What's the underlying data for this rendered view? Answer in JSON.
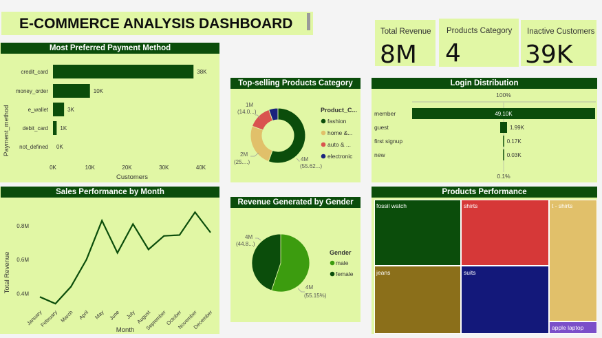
{
  "header": {
    "title": "E-COMMERCE ANALYSIS DASHBOARD"
  },
  "kpis": [
    {
      "label": "Total Revenue",
      "value": "8M"
    },
    {
      "label": "Products Category",
      "value": "4"
    },
    {
      "label": "Inactive Customers",
      "value": "39K"
    }
  ],
  "colors": {
    "panel": "#e1f7a5",
    "title_bar": "#0b4d0b",
    "dark_green": "#0b4d0b",
    "accent_green": "#3c9c0f"
  },
  "payment": {
    "title": "Most Preferred Payment Method",
    "ylabel": "Payment_method",
    "xlabel": "Customers",
    "ticks": [
      "0K",
      "10K",
      "20K",
      "30K",
      "40K"
    ],
    "chart_data": {
      "type": "bar",
      "orientation": "horizontal",
      "categories": [
        "credit_card",
        "money_order",
        "e_wallet",
        "debit_card",
        "not_defined"
      ],
      "values": [
        38000,
        10000,
        3000,
        1000,
        0
      ],
      "data_labels": [
        "38K",
        "10K",
        "3K",
        "1K",
        "0K"
      ],
      "xlim": [
        0,
        40000
      ]
    }
  },
  "category": {
    "title": "Top-selling Products Category",
    "legend_title": "Product_C...",
    "legend": [
      "fashion",
      "home &...",
      "auto & ...",
      "electronic"
    ],
    "labels": [
      {
        "line1": "4M",
        "line2": "(55.62...)"
      },
      {
        "line1": "2M",
        "line2": "(25....)"
      },
      {
        "line1": "1M",
        "line2": "(14.0...)"
      }
    ],
    "chart_data": {
      "type": "pie",
      "variant": "donut",
      "categories": [
        "fashion",
        "home & ...",
        "auto & ...",
        "electronic"
      ],
      "values": [
        55.62,
        25,
        14,
        5.38
      ],
      "colors": [
        "#0b4d0b",
        "#e1c06a",
        "#d9534f",
        "#1a237e"
      ]
    }
  },
  "login": {
    "title": "Login Distribution",
    "top_label": "100%",
    "bottom_label": "0.1%",
    "chart_data": {
      "type": "bar",
      "variant": "funnel",
      "categories": [
        "member",
        "guest",
        "first signup",
        "new"
      ],
      "values": [
        49100,
        1990,
        170,
        30
      ],
      "data_labels": [
        "49.10K",
        "1.99K",
        "0.17K",
        "0.03K"
      ]
    }
  },
  "sales": {
    "title": "Sales Performance by Month",
    "ylabel": "Total Revenue",
    "xlabel": "Month",
    "yticks": [
      "0.8M",
      "0.6M",
      "0.4M"
    ],
    "chart_data": {
      "type": "line",
      "categories": [
        "January",
        "February",
        "March",
        "April",
        "May",
        "June",
        "July",
        "August",
        "September",
        "October",
        "November",
        "December"
      ],
      "values": [
        0.38,
        0.34,
        0.44,
        0.6,
        0.83,
        0.64,
        0.81,
        0.66,
        0.74,
        0.745,
        0.88,
        0.76
      ],
      "ylim": [
        0.3,
        0.95
      ]
    }
  },
  "gender": {
    "title": "Revenue Generated by Gender",
    "legend_title": "Gender",
    "legend": [
      "male",
      "female"
    ],
    "labels": [
      {
        "line1": "4M",
        "line2": "(44.8...)"
      },
      {
        "line1": "4M",
        "line2": "(55.15%)"
      }
    ],
    "chart_data": {
      "type": "pie",
      "categories": [
        "male",
        "female"
      ],
      "values": [
        55.15,
        44.85
      ],
      "colors": [
        "#3c9c0f",
        "#0b4d0b"
      ]
    }
  },
  "products": {
    "title": "Products Performance",
    "chart_data": {
      "type": "treemap",
      "categories": [
        "fossil watch",
        "shirts",
        "t - shirts",
        "jeans",
        "suits",
        "apple laptop"
      ],
      "colors": [
        "#0b4d0b",
        "#d63838",
        "#e1c06a",
        "#8b6f1a",
        "#13187a",
        "#7b4fc9"
      ]
    }
  }
}
